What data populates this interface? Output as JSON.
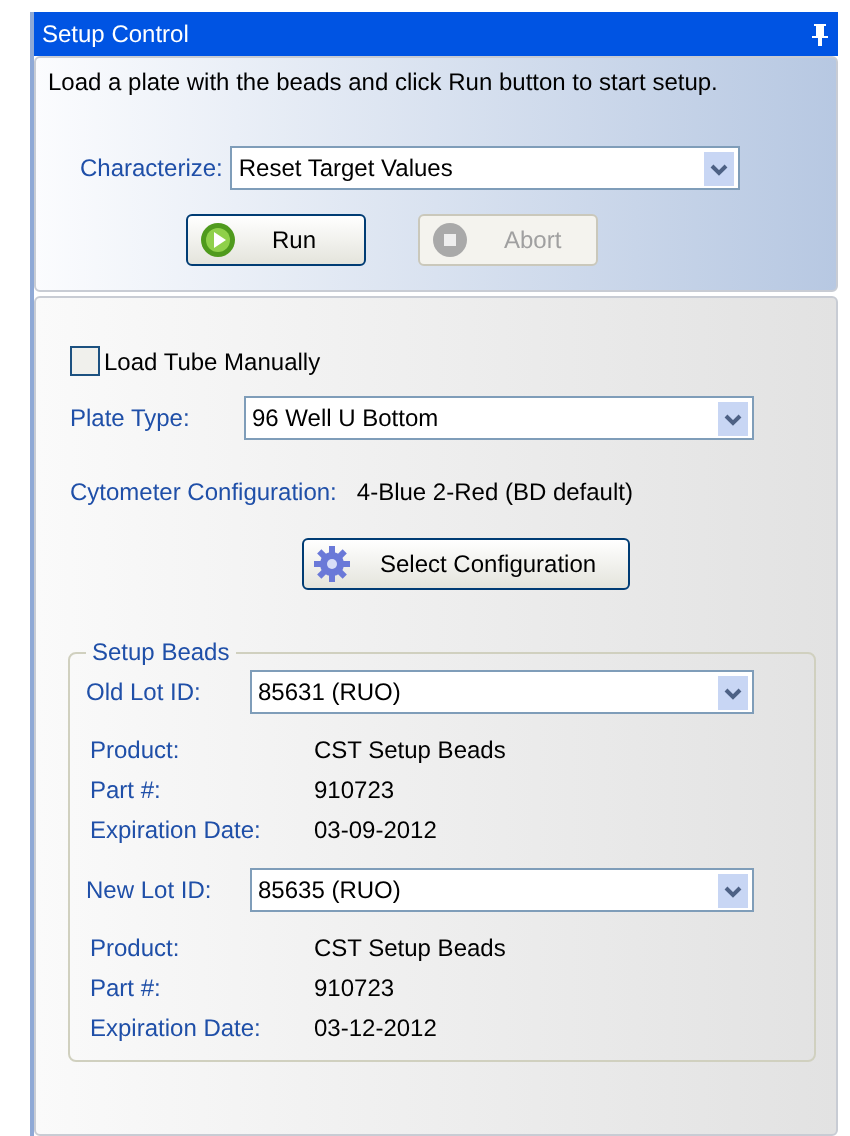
{
  "window": {
    "title": "Setup Control"
  },
  "instruction": "Load a plate with the beads and click Run button to start setup.",
  "characterize": {
    "label": "Characterize:",
    "value": "Reset Target Values"
  },
  "buttons": [
    {
      "label": "Run",
      "kind": "run",
      "disabled": false
    },
    {
      "label": "Abort",
      "kind": "abort",
      "disabled": true
    }
  ],
  "load_tube": {
    "label": "Load Tube Manually",
    "checked": false
  },
  "plate_type": {
    "label": "Plate Type:",
    "value": "96 Well U Bottom"
  },
  "cytometer": {
    "label": "Cytometer Configuration:",
    "value": "4-Blue 2-Red (BD default)"
  },
  "select_button": {
    "label": "Select Configuration"
  },
  "setup_beads": {
    "title": "Setup Beads",
    "lots": [
      {
        "label": "Old Lot ID:",
        "value": "85631 (RUO)",
        "details": [
          {
            "label": "Product:",
            "value": "CST Setup Beads"
          },
          {
            "label": "Part #:",
            "value": "910723"
          },
          {
            "label": "Expiration Date:",
            "value": "03-09-2012"
          }
        ]
      },
      {
        "label": "New Lot ID:",
        "value": "85635 (RUO)",
        "details": [
          {
            "label": "Product:",
            "value": "CST Setup Beads"
          },
          {
            "label": "Part #:",
            "value": "910723"
          },
          {
            "label": "Expiration Date:",
            "value": "03-12-2012"
          }
        ]
      }
    ]
  }
}
